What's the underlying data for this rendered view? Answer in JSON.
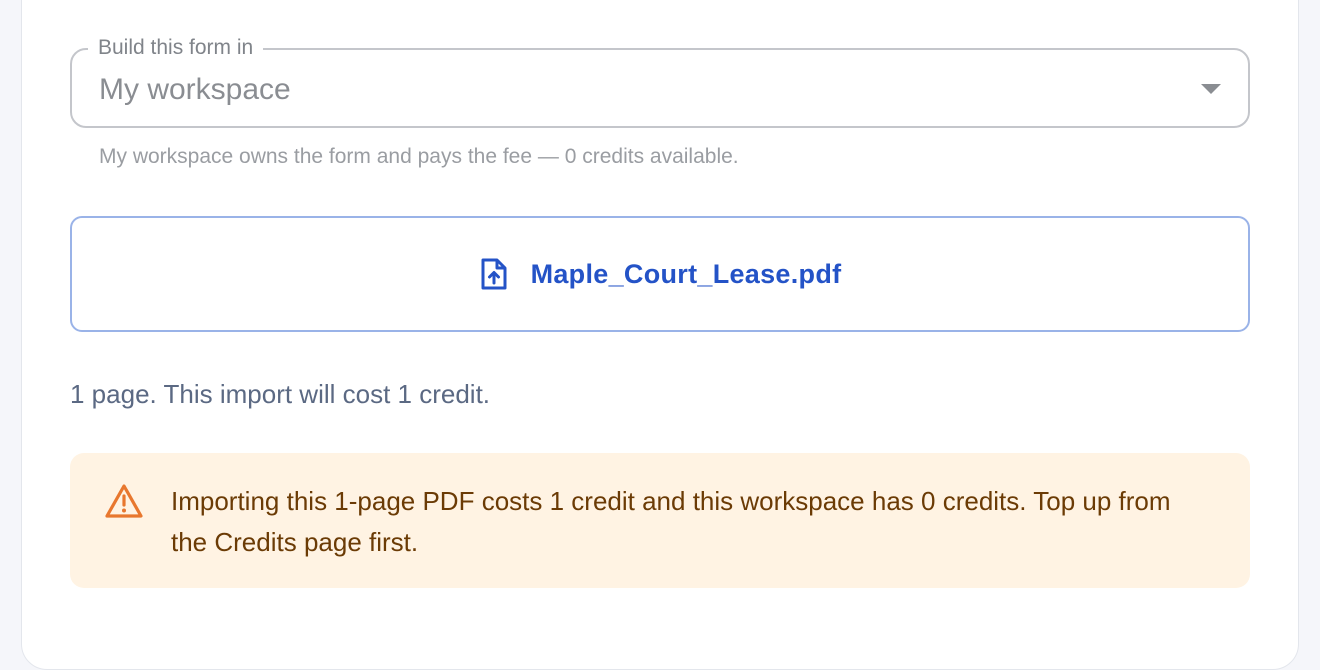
{
  "workspace_select": {
    "legend": "Build this form in",
    "value": "My workspace",
    "helper": "My workspace owns the form and pays the fee — 0 credits available."
  },
  "file_upload": {
    "file_name": "Maple_Court_Lease.pdf",
    "icon": "file-upload-icon"
  },
  "cost_summary": "1 page. This import will cost 1 credit.",
  "warning_alert": {
    "icon": "warning-triangle-icon",
    "message": "Importing this 1-page PDF costs 1 credit and this workspace has 0 credits. Top up from the Credits page first."
  },
  "colors": {
    "accent": "#2453c7",
    "warning_bg": "#fff3e3",
    "warning_text": "#6b3b05",
    "warning_icon": "#e8772e"
  }
}
